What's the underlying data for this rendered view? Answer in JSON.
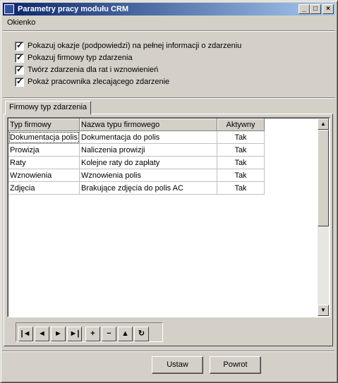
{
  "window": {
    "title": "Parametry pracy modułu CRM"
  },
  "menu": {
    "items": [
      {
        "label": "Okienko"
      }
    ]
  },
  "options": [
    {
      "label": "Pokazuj okazje (podpowiedzi) na pełnej informacji o zdarzeniu",
      "checked": true
    },
    {
      "label": "Pokazuj firmowy typ zdarzenia",
      "checked": true
    },
    {
      "label": "Twórz zdarzenia dla rat i wznowienień",
      "checked": true
    },
    {
      "label": "Pokaż pracownika zlecającego zdarzenie",
      "checked": true
    }
  ],
  "tab": {
    "label": "Firmowy typ zdarzenia"
  },
  "grid": {
    "columns": [
      "Typ firmowy",
      "Nazwa typu firmowego",
      "Aktywny"
    ],
    "rows": [
      [
        "Dokumentacja polis",
        "Dokumentacja do polis",
        "Tak"
      ],
      [
        "Prowizja",
        "Naliczenia prowizji",
        "Tak"
      ],
      [
        "Raty",
        "Kolejne raty do zapłaty",
        "Tak"
      ],
      [
        "Wznowienia",
        "Wznowienia polis",
        "Tak"
      ],
      [
        "Zdjęcia",
        "Brakujące zdjęcia do polis AC",
        "Tak"
      ]
    ]
  },
  "nav_icons": {
    "first": "|◄",
    "prior": "◄",
    "next": "►",
    "last": "►|",
    "insert": "+",
    "delete": "−",
    "edit": "▲",
    "refresh": "↻"
  },
  "buttons": {
    "set": "Ustaw",
    "back": "Powrot"
  }
}
